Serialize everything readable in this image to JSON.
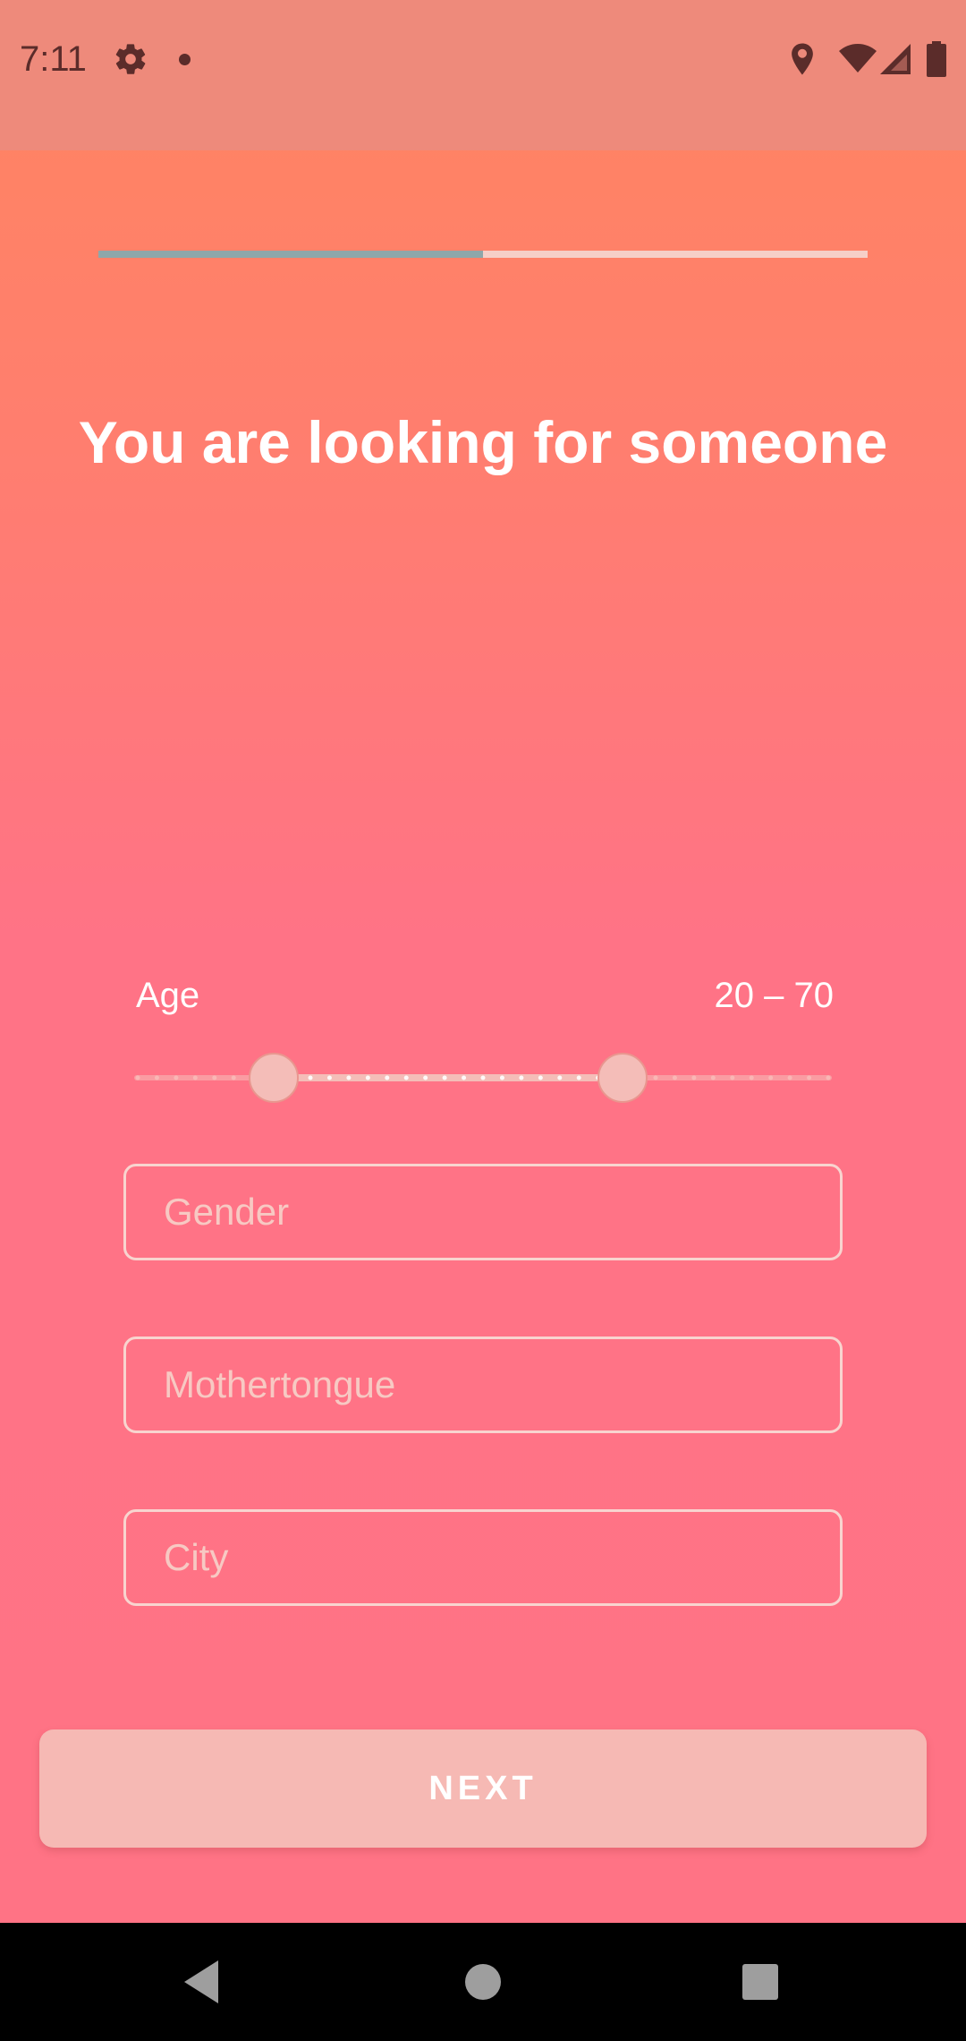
{
  "status_bar": {
    "time": "7:11",
    "icons": [
      "gear-icon",
      "notification-dot-icon",
      "location-icon",
      "wifi-icon",
      "cell-signal-icon",
      "battery-icon"
    ]
  },
  "progress": {
    "fraction": 0.5,
    "fill_color": "#8EA7AA",
    "track_color": "#F6CFC8"
  },
  "title": "You are looking for someone",
  "age": {
    "label": "Age",
    "value_text": "20 – 70",
    "min": 20,
    "max": 70,
    "range_min": 0,
    "range_max": 100
  },
  "fields": {
    "gender": {
      "placeholder": "Gender",
      "value": ""
    },
    "mothertongue": {
      "placeholder": "Mothertongue",
      "value": ""
    },
    "city": {
      "placeholder": "City",
      "value": ""
    }
  },
  "next_button": {
    "label": "NEXT"
  },
  "nav_bar": {
    "icons": [
      "back-icon",
      "home-icon",
      "recents-icon"
    ]
  },
  "colors": {
    "gradient_top": "#FF8560",
    "gradient_bottom": "#FF7385",
    "button_bg": "#F6B9B4",
    "status_bar_bg": "#EE8A7B"
  }
}
